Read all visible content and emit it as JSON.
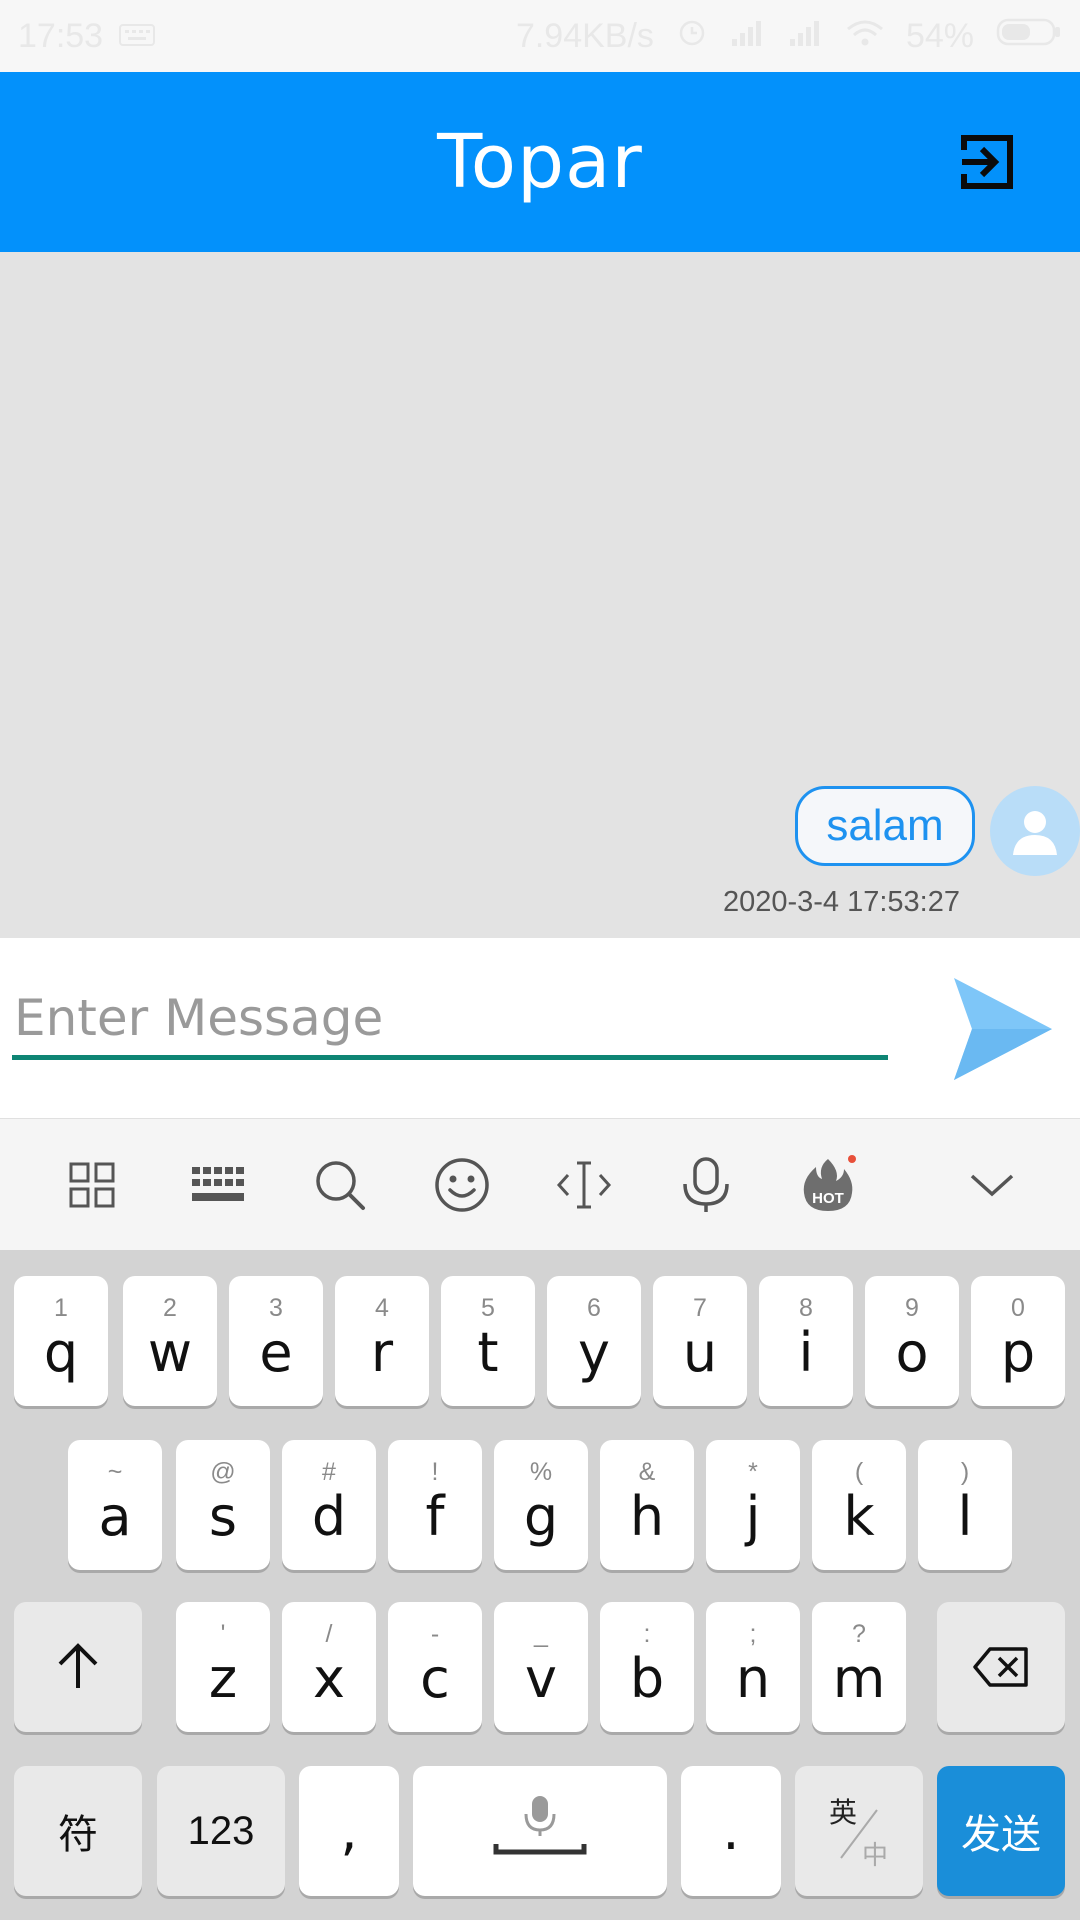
{
  "status_bar": {
    "time": "17:53",
    "network_speed": "7.94KB/s",
    "battery": "54%"
  },
  "header": {
    "title": "Topar",
    "exit_icon": "logout-icon"
  },
  "chat": {
    "messages": [
      {
        "text": "salam",
        "time": "2020-3-4 17:53:27"
      }
    ]
  },
  "composer": {
    "placeholder": "Enter Message",
    "value": "",
    "send_icon": "send-icon"
  },
  "keyboard_toolbar": {
    "icons": [
      "grid-icon",
      "keyboard-icon",
      "search-icon",
      "emoji-icon",
      "cursor-icon",
      "microphone-icon",
      "hot-icon",
      "chevron-down-icon"
    ],
    "hot_label": "HOT"
  },
  "keyboard": {
    "row1": [
      {
        "main": "q",
        "sub": "1"
      },
      {
        "main": "w",
        "sub": "2"
      },
      {
        "main": "e",
        "sub": "3"
      },
      {
        "main": "r",
        "sub": "4"
      },
      {
        "main": "t",
        "sub": "5"
      },
      {
        "main": "y",
        "sub": "6"
      },
      {
        "main": "u",
        "sub": "7"
      },
      {
        "main": "i",
        "sub": "8"
      },
      {
        "main": "o",
        "sub": "9"
      },
      {
        "main": "p",
        "sub": "0"
      }
    ],
    "row2": [
      {
        "main": "a",
        "sub": "~"
      },
      {
        "main": "s",
        "sub": "@"
      },
      {
        "main": "d",
        "sub": "#"
      },
      {
        "main": "f",
        "sub": "!"
      },
      {
        "main": "g",
        "sub": "%"
      },
      {
        "main": "h",
        "sub": "&"
      },
      {
        "main": "j",
        "sub": "*"
      },
      {
        "main": "k",
        "sub": "("
      },
      {
        "main": "l",
        "sub": ")"
      }
    ],
    "row3": [
      {
        "main": "z",
        "sub": "'"
      },
      {
        "main": "x",
        "sub": "/"
      },
      {
        "main": "c",
        "sub": "-"
      },
      {
        "main": "v",
        "sub": "_"
      },
      {
        "main": "b",
        "sub": ":"
      },
      {
        "main": "n",
        "sub": ";"
      },
      {
        "main": "m",
        "sub": "?"
      }
    ],
    "symbols_label": "符",
    "numbers_label": "123",
    "comma_label": ",",
    "period_label": ".",
    "lang_top": "英",
    "lang_bottom": "中",
    "send_label": "发送",
    "accent_color": "#1a8ed9"
  }
}
